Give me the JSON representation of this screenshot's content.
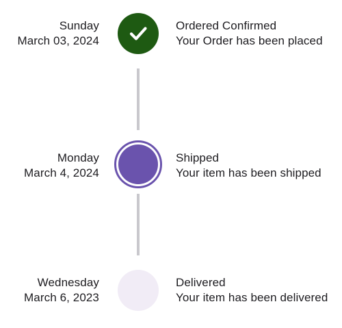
{
  "steps": [
    {
      "day": "Sunday",
      "date": "March 03, 2024",
      "title": "Ordered Confirmed",
      "description": "Your Order has been placed",
      "state": "completed",
      "indicator_color": "#1e5a12",
      "icon": "checkmark-icon"
    },
    {
      "day": "Monday",
      "date": "March 4, 2024",
      "title": "Shipped",
      "description": "Your item has been shipped",
      "state": "current",
      "indicator_color": "#6a53ad",
      "icon": ""
    },
    {
      "day": "Wednesday",
      "date": "March 6, 2023",
      "title": "Delivered",
      "description": "Your item has been delivered",
      "state": "pending",
      "indicator_color": "#f1ecf6",
      "icon": ""
    }
  ],
  "colors": {
    "connector": "#c9c8cd",
    "text": "#1c1b1f"
  }
}
